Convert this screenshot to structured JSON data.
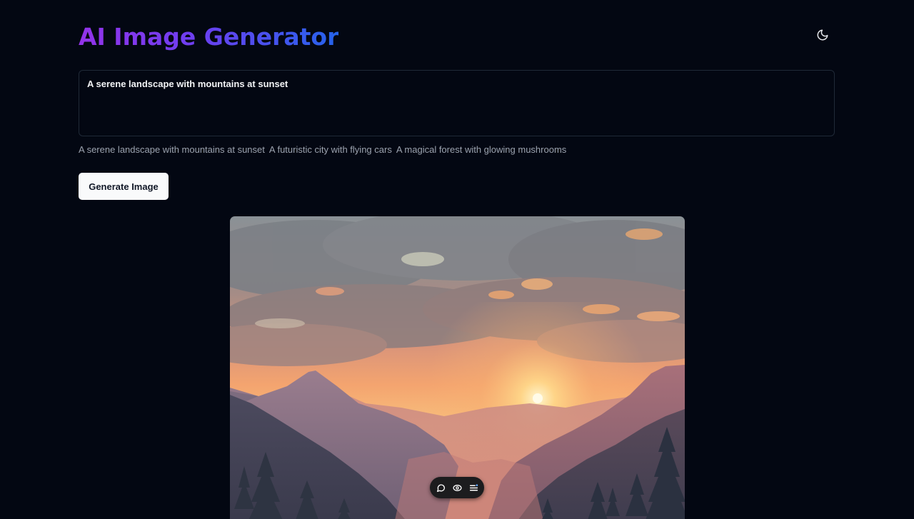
{
  "header": {
    "title": "AI Image Generator",
    "theme_toggle_icon": "moon-icon"
  },
  "prompt": {
    "value": "A serene landscape with mountains at sunset"
  },
  "suggestions": [
    "A serene landscape with mountains at sunset",
    "A futuristic city with flying cars",
    "A magical forest with glowing mushrooms"
  ],
  "actions": {
    "generate_label": "Generate Image"
  },
  "toolbar": {
    "icons": [
      "comment-icon",
      "eye-icon",
      "menu-lines-icon"
    ]
  },
  "colors": {
    "background": "#030712",
    "title_gradient_start": "#9333ea",
    "title_gradient_end": "#2563eb",
    "button_bg": "#f9fafb"
  }
}
